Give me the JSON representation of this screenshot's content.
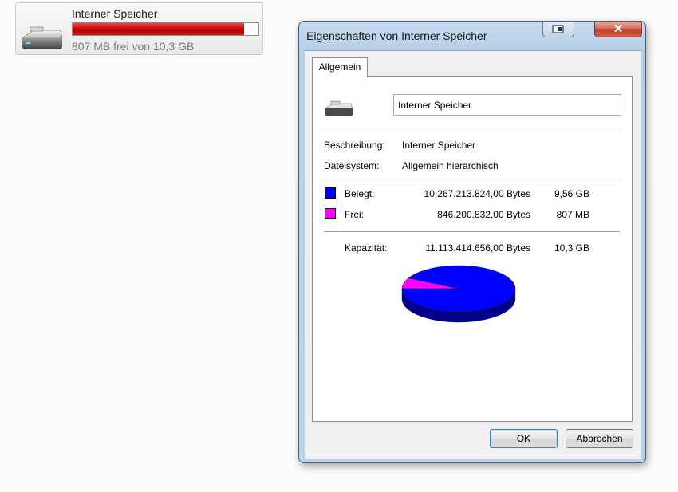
{
  "explorer": {
    "drive_name": "Interner Speicher",
    "drive_free_text": "807 MB frei von 10,3 GB",
    "used_fraction": 0.924,
    "drive_icon": "removable-drive-icon"
  },
  "dialog": {
    "title": "Eigenschaften von Interner Speicher",
    "restore_icon": "restore-icon",
    "close_icon": "close-icon",
    "close_glyph": "✕",
    "tab_label": "Allgemein",
    "name_value": "Interner Speicher",
    "description_label": "Beschreibung:",
    "description_value": "Interner Speicher",
    "filesystem_label": "Dateisystem:",
    "filesystem_value": "Allgemein hierarchisch",
    "used": {
      "label": "Belegt:",
      "bytes": "10.267.213.824,00 Bytes",
      "size": "9,56 GB",
      "color": "#0000ff"
    },
    "free": {
      "label": "Frei:",
      "bytes": "846.200.832,00 Bytes",
      "size": "807 MB",
      "color": "#ff00ff"
    },
    "capacity": {
      "label": "Kapazität:",
      "bytes": "11.113.414.656,00 Bytes",
      "size": "10,3 GB"
    },
    "ok_label": "OK",
    "cancel_label": "Abbrechen"
  },
  "chart_data": {
    "type": "pie",
    "categories": [
      "Belegt",
      "Frei"
    ],
    "values": [
      10267213824,
      846200832
    ],
    "colors": [
      "#0000ff",
      "#ff00ff"
    ]
  }
}
